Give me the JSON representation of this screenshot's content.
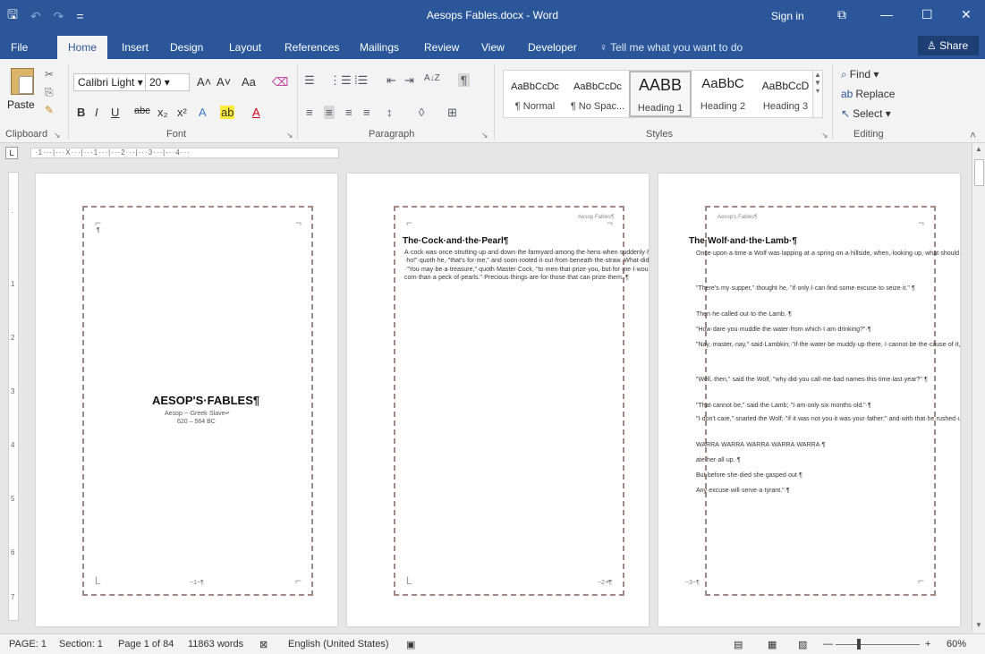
{
  "titlebar": {
    "doc_title": "Aesops Fables.docx - Word",
    "sign_in": "Sign in",
    "save_glyph": "🖫",
    "undo_glyph": "↶",
    "redo_glyph": "↷",
    "customize_glyph": "=",
    "ribbon_opts_glyph": "⧉",
    "min_glyph": "—",
    "max_glyph": "☐",
    "close_glyph": "✕"
  },
  "tabs": [
    "File",
    "Home",
    "Insert",
    "Design",
    "Layout",
    "References",
    "Mailings",
    "Review",
    "View",
    "Developer"
  ],
  "tell_me": "Tell me what you want to do",
  "share": "Share",
  "ribbon": {
    "clipboard": {
      "paste": "Paste",
      "label": "Clipboard"
    },
    "font": {
      "name": "Calibri Light",
      "size": "20",
      "label": "Font",
      "grow": "A˄",
      "shrink": "A˅",
      "case": "Aa",
      "clear": "⌫",
      "bold": "B",
      "italic": "I",
      "underline": "U",
      "strike": "abc",
      "sub": "x₂",
      "sup": "x²",
      "effects": "A",
      "highlight": "ab",
      "color": "A"
    },
    "paragraph": {
      "label": "Paragraph",
      "bullets": "☰",
      "numbering": "⋮☰",
      "multilevel": "⁞☰",
      "dec_indent": "⇤",
      "inc_indent": "⇥",
      "sort": "A↓Z",
      "pilcrow": "¶",
      "al_left": "≡",
      "al_center": "≡",
      "al_right": "≡",
      "justify": "≡",
      "spacing": "↕",
      "shading": "◊",
      "borders": "⊞"
    },
    "styles": {
      "label": "Styles",
      "items": [
        {
          "preview": "AaBbCcDc",
          "name": "¶ Normal"
        },
        {
          "preview": "AaBbCcDc",
          "name": "¶ No Spac..."
        },
        {
          "preview": "AABB",
          "name": "Heading 1"
        },
        {
          "preview": "AaBbC",
          "name": "Heading 2"
        },
        {
          "preview": "AaBbCcD",
          "name": "Heading 3"
        }
      ]
    },
    "editing": {
      "label": "Editing",
      "find": "Find",
      "replace": "Replace",
      "select": "Select"
    }
  },
  "ruler": {
    "tab_glyph": "L",
    "marks": "·1···|···Ⅹ···|···1···|···2···|···3···|···4···"
  },
  "pages": [
    {
      "cover_title": "AESOP'S·FABLES¶",
      "cover_sub1": "Aesop·~·Greek·Slave↵",
      "cover_sub2": "620 – 564 BC",
      "footer": "~1~¶",
      "pilcrow": "¶"
    },
    {
      "header": "Aesop·Fables¶",
      "heading": "The·Cock·and·the·Pearl¶",
      "text": "A·cock·was·once·strutting·up·and·down·the·farmyard·among·the·hens·when·suddenly·he·espied·something·shinning·amid·the·straw.·\"Ho!·ho!\"·quoth·he,·\"that's·for·me,\"·and·soon·rooted·it·out·from·beneath·the·straw.·What·did·it·turn·out·to·be·but·a·Pearl·that·by·some·chance·had·been·lost·in·the·yard?·\"You·may·be·a·treasure,\"·quoth·Master·Cock,·\"to·men·that·prize·you,·but·for·me·I·would·rather·have·a·single·barley-corn·than·a·peck·of·pearls.\"·Precious·things·are·for·those·that·can·prize·them.·¶",
      "footer": "~2~¶"
    },
    {
      "header": "Aesop's·Fables¶",
      "heading": "The·Wolf·and·the·Lamb·¶",
      "paras": [
        "Once·upon·a·time·a·Wolf·was·lapping·at·a·spring·on·a·hillside,·when,·looking·up,·what·should·he·see·but·a·Lamb·just·beginning·to·drink·a·little·lower·down.·¶",
        "\"There's·my·supper,\"·thought·he,·\"if·only·I·can·find·some·excuse·to·seize·it.\"·¶",
        "Then·he·called·out·to·the·Lamb,·¶",
        "\"How·dare·you·muddle·the·water·from·which·I·am·drinking?\"·¶",
        "\"Nay,·master,·nay,\"·said·Lambkin;·\"if·the·water·be·muddy·up·there,·I·cannot·be·the·cause·of·it,·for·it·runs·down·from·you·to·me.\"·¶",
        "\"Well,·then,\"·said·the·Wolf,·\"why·did·you·call·me·bad·names·this·time·last·year?\"·¶",
        "\"That·cannot·be,\"·said·the·Lamb;·\"I·am·only·six·months·old.\"·¶",
        "\"I·don't·care,\"·snarled·the·Wolf;·\"if·it·was·not·you·it·was·your·father;\"·and·with·that·he·rushed·upon·the·poor·little·Lamb·and·¶",
        "WARRA·WARRA·WARRA·WARRA·WARRA·¶",
        "ate·her·all·up.·¶",
        "But·before·she·died·she·gasped·out·¶",
        "Any·excuse·will·serve·a·tyrant.\"·¶"
      ],
      "footer": "~3~¶"
    }
  ],
  "status": {
    "page": "PAGE: 1",
    "section": "Section: 1",
    "page_of": "Page 1 of 84",
    "words": "11863 words",
    "language": "English (United States)",
    "zoom": "60%",
    "minus": "—",
    "plus": "+"
  },
  "colors": {
    "brand": "#2b579a",
    "ribbon_bg": "#f3f3f3"
  }
}
